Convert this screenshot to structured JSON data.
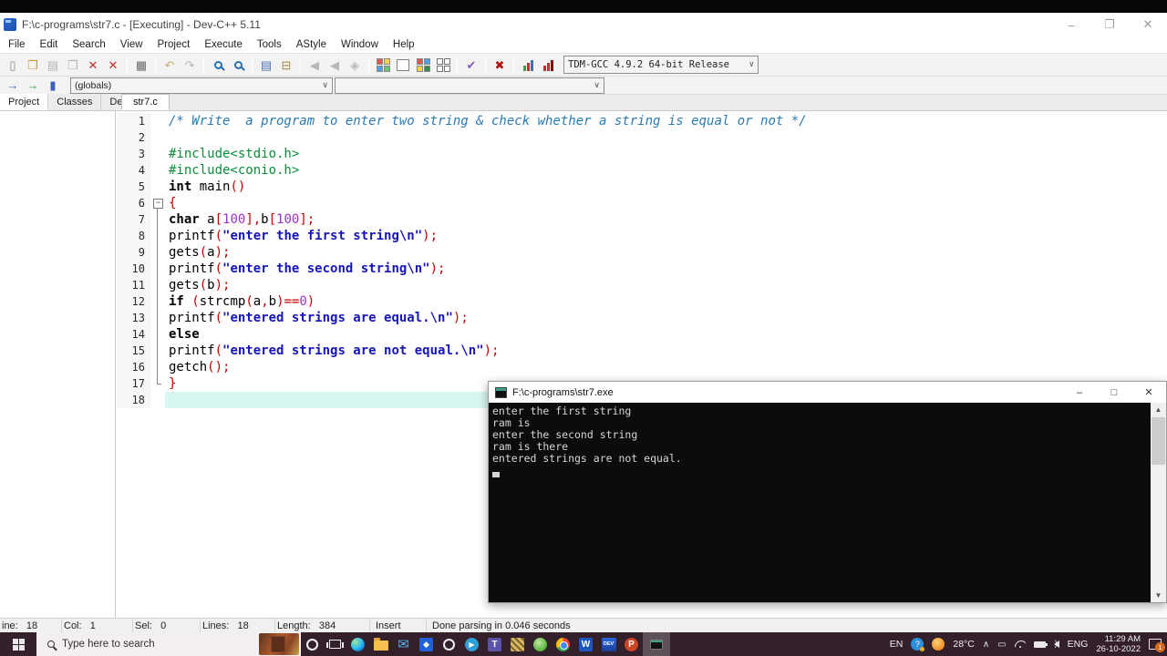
{
  "window": {
    "title": "F:\\c-programs\\str7.c - [Executing] - Dev-C++ 5.11",
    "controls": {
      "minimize": "–",
      "maximize": "❐",
      "close": "✕"
    }
  },
  "menu": [
    "File",
    "Edit",
    "Search",
    "View",
    "Project",
    "Execute",
    "Tools",
    "AStyle",
    "Window",
    "Help"
  ],
  "toolbar1": {
    "groups": [
      [
        {
          "name": "new-file-icon",
          "kind": "glyph",
          "glyph": "▯",
          "color": "#8a8a8a"
        },
        {
          "name": "open-file-icon",
          "kind": "glyph",
          "glyph": "❐",
          "color": "#c09a3e"
        },
        {
          "name": "save-icon",
          "kind": "glyph",
          "glyph": "▤",
          "color": "#b4b4b4"
        },
        {
          "name": "save-all-icon",
          "kind": "glyph",
          "glyph": "❒",
          "color": "#b4b4b4"
        },
        {
          "name": "close-file-icon",
          "kind": "glyph",
          "glyph": "✕",
          "color": "#c03030"
        },
        {
          "name": "close-all-icon",
          "kind": "glyph",
          "glyph": "✕",
          "color": "#c03030"
        }
      ],
      [
        {
          "name": "print-icon",
          "kind": "glyph",
          "glyph": "▦",
          "color": "#6a6a6a"
        }
      ],
      [
        {
          "name": "undo-icon",
          "kind": "glyph",
          "glyph": "↶",
          "color": "#c8b078"
        },
        {
          "name": "redo-icon",
          "kind": "glyph",
          "glyph": "↷",
          "color": "#b8b8b8"
        }
      ],
      [
        {
          "name": "find-icon",
          "kind": "mag"
        },
        {
          "name": "replace-icon",
          "kind": "mag"
        }
      ],
      [
        {
          "name": "goto-line-icon",
          "kind": "glyph",
          "glyph": "▤",
          "color": "#4a6fb0"
        },
        {
          "name": "bookmark-icon",
          "kind": "glyph",
          "glyph": "⊟",
          "color": "#a08a40"
        }
      ],
      [
        {
          "name": "nav-back-icon",
          "kind": "glyph",
          "glyph": "◀",
          "color": "#b8b8b8"
        },
        {
          "name": "nav-forward-icon",
          "kind": "glyph",
          "glyph": "◀",
          "color": "#b8b8b8"
        },
        {
          "name": "shield-icon",
          "kind": "glyph",
          "glyph": "◈",
          "color": "#b8b8b8"
        }
      ],
      [
        {
          "name": "compile-icon",
          "kind": "grid",
          "colors": [
            "#e05a4e",
            "#f5d34e",
            "#4ea0e0",
            "#6fc26f"
          ]
        },
        {
          "name": "run-icon",
          "kind": "square"
        },
        {
          "name": "compile-run-icon",
          "kind": "grid",
          "colors": [
            "#e05a4e",
            "#4ea0e0",
            "#f5d34e",
            "#2f8f4f"
          ]
        },
        {
          "name": "rebuild-all-icon",
          "kind": "outline-grid"
        }
      ],
      [
        {
          "name": "syntax-check-icon",
          "kind": "glyph",
          "glyph": "✔",
          "color": "#8a5ac2"
        }
      ],
      [
        {
          "name": "abort-icon",
          "kind": "glyph",
          "glyph": "✖",
          "color": "#b01818"
        }
      ],
      [
        {
          "name": "profile-icon",
          "kind": "bars",
          "colors": [
            "#3f9e4f",
            "#c03030",
            "#3f6fb0"
          ]
        },
        {
          "name": "profiling-delete-icon",
          "kind": "bars",
          "colors": [
            "#c03030",
            "#c03030",
            "#801010"
          ]
        }
      ]
    ],
    "compiler_select": "TDM-GCC 4.9.2 64-bit Release"
  },
  "toolbar2": {
    "icons": [
      {
        "name": "goto-declaration-icon",
        "kind": "glyph",
        "glyph": "→",
        "color": "#3a5fc0"
      },
      {
        "name": "goto-implementation-icon",
        "kind": "glyph",
        "glyph": "→",
        "color": "#2f9f3f"
      },
      {
        "name": "show-file-icon",
        "kind": "glyph",
        "glyph": "▮",
        "color": "#3a5fc0"
      }
    ],
    "globals_select": "(globals)",
    "members_select": ""
  },
  "panel_tabs": [
    "Project",
    "Classes",
    "Debug"
  ],
  "file_tab": "str7.c",
  "editor": {
    "current_line": 18,
    "lines": [
      {
        "n": 1,
        "fold": "",
        "tokens": [
          [
            "cm",
            "/* Write  a program to enter two string & check whether a string is equal or not */"
          ]
        ]
      },
      {
        "n": 2,
        "fold": "",
        "tokens": []
      },
      {
        "n": 3,
        "fold": "",
        "tokens": [
          [
            "inc",
            "#include<stdio.h>"
          ]
        ]
      },
      {
        "n": 4,
        "fold": "",
        "tokens": [
          [
            "inc",
            "#include<conio.h>"
          ]
        ]
      },
      {
        "n": 5,
        "fold": "",
        "tokens": [
          [
            "kw",
            "int"
          ],
          [
            "pl",
            " main"
          ],
          [
            "red",
            "()"
          ]
        ]
      },
      {
        "n": 6,
        "fold": "open",
        "tokens": [
          [
            "red",
            "{"
          ]
        ]
      },
      {
        "n": 7,
        "fold": "line",
        "tokens": [
          [
            "kw",
            "char"
          ],
          [
            "pl",
            " a"
          ],
          [
            "red",
            "["
          ],
          [
            "num",
            "100"
          ],
          [
            "red",
            "],"
          ],
          [
            "pl",
            "b"
          ],
          [
            "red",
            "["
          ],
          [
            "num",
            "100"
          ],
          [
            "red",
            "];"
          ]
        ]
      },
      {
        "n": 8,
        "fold": "line",
        "tokens": [
          [
            "pl",
            "printf"
          ],
          [
            "red",
            "("
          ],
          [
            "str",
            "\"enter the first string\\n\""
          ],
          [
            "red",
            ");"
          ]
        ]
      },
      {
        "n": 9,
        "fold": "line",
        "tokens": [
          [
            "pl",
            "gets"
          ],
          [
            "red",
            "("
          ],
          [
            "pl",
            "a"
          ],
          [
            "red",
            ");"
          ]
        ]
      },
      {
        "n": 10,
        "fold": "line",
        "tokens": [
          [
            "pl",
            "printf"
          ],
          [
            "red",
            "("
          ],
          [
            "str",
            "\"enter the second string\\n\""
          ],
          [
            "red",
            ");"
          ]
        ]
      },
      {
        "n": 11,
        "fold": "line",
        "tokens": [
          [
            "pl",
            "gets"
          ],
          [
            "red",
            "("
          ],
          [
            "pl",
            "b"
          ],
          [
            "red",
            ");"
          ]
        ]
      },
      {
        "n": 12,
        "fold": "line",
        "tokens": [
          [
            "kw",
            "if"
          ],
          [
            "pl",
            " "
          ],
          [
            "red",
            "("
          ],
          [
            "pl",
            "strcmp"
          ],
          [
            "red",
            "("
          ],
          [
            "pl",
            "a"
          ],
          [
            "red",
            ","
          ],
          [
            "pl",
            "b"
          ],
          [
            "red",
            ")=="
          ],
          [
            "num",
            "0"
          ],
          [
            "red",
            ")"
          ]
        ]
      },
      {
        "n": 13,
        "fold": "line",
        "tokens": [
          [
            "pl",
            "printf"
          ],
          [
            "red",
            "("
          ],
          [
            "str",
            "\"entered strings are equal.\\n\""
          ],
          [
            "red",
            ");"
          ]
        ]
      },
      {
        "n": 14,
        "fold": "line",
        "tokens": [
          [
            "kw",
            "else"
          ]
        ]
      },
      {
        "n": 15,
        "fold": "line",
        "tokens": [
          [
            "pl",
            "printf"
          ],
          [
            "red",
            "("
          ],
          [
            "str",
            "\"entered strings are not equal.\\n\""
          ],
          [
            "red",
            ");"
          ]
        ]
      },
      {
        "n": 16,
        "fold": "line",
        "tokens": [
          [
            "pl",
            "getch"
          ],
          [
            "red",
            "();"
          ]
        ]
      },
      {
        "n": 17,
        "fold": "end",
        "tokens": [
          [
            "red",
            "}"
          ]
        ]
      },
      {
        "n": 18,
        "fold": "",
        "tokens": []
      }
    ]
  },
  "console": {
    "title": "F:\\c-programs\\str7.exe",
    "controls": {
      "minimize": "–",
      "maximize": "□",
      "close": "✕"
    },
    "lines": [
      "enter the first string",
      "ram is",
      "enter the second string",
      "ram is there",
      "entered strings are not equal."
    ]
  },
  "statusbar": {
    "segments": [
      "ine:   18",
      "Col:   1",
      "Sel:   0",
      "Lines:   18",
      "Length:   384",
      "Insert",
      "Done parsing in 0.046 seconds"
    ]
  },
  "taskbar": {
    "search_placeholder": "Type here to search",
    "app_icons": [
      "cortana",
      "taskview",
      "edge",
      "folder",
      "mail",
      "dropbox",
      "ring-app",
      "telegram",
      "teams",
      "checkered",
      "green-app",
      "chrome",
      "word",
      "dev-cpp",
      "powerpoint"
    ],
    "dev_label": "DEV",
    "word_label": "W",
    "teams_label": "T",
    "ppt_label": "P",
    "telegram_label": "▶",
    "dropbox_label": "◆",
    "tray": {
      "lang_short": "EN",
      "help_glyph": "?",
      "temperature": "28°C",
      "chevron": "∧",
      "lang_long": "ENG",
      "time": "11:29 AM",
      "date": "26-10-2022",
      "notification_count": "1"
    }
  }
}
